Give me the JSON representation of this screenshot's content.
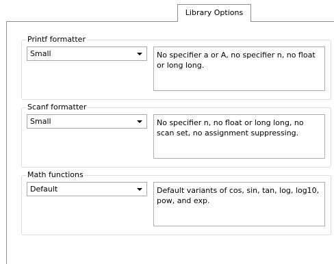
{
  "tabs": {
    "active_label": "Library Options"
  },
  "groups": [
    {
      "title": "Printf formatter",
      "selected": "Small",
      "description": "No specifier a or A, no specifier n, no float or long long."
    },
    {
      "title": "Scanf formatter",
      "selected": "Small",
      "description": "No specifier n, no float or long long, no scan set, no assignment suppressing."
    },
    {
      "title": "Math functions",
      "selected": "Default",
      "description": "Default variants of cos, sin, tan, log, log10, pow, and exp."
    }
  ],
  "icons": {
    "dropdown": "chevron-down-icon"
  }
}
